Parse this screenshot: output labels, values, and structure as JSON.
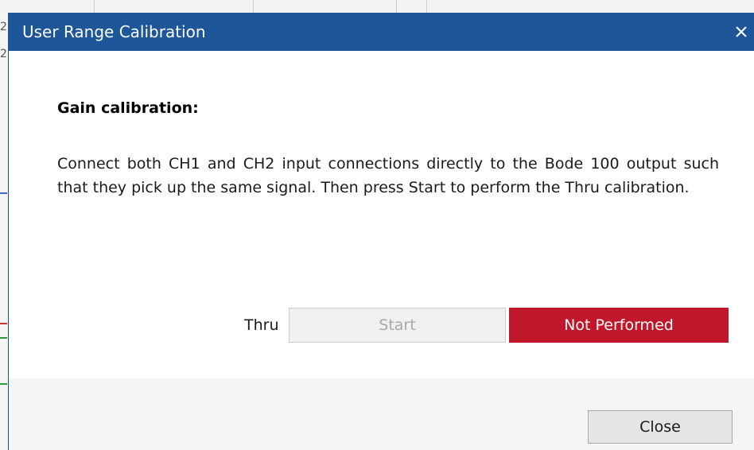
{
  "dialog": {
    "title": "User Range Calibration",
    "close_icon": "close-icon"
  },
  "content": {
    "heading": "Gain calibration:",
    "instructions": "Connect both CH1 and CH2 input connections directly to the Bode 100 output such that they pick up the same signal. Then press Start to perform the Thru calibration."
  },
  "calibration_row": {
    "label": "Thru",
    "start_label": "Start",
    "status": "Not Performed",
    "status_color": "#c0182a"
  },
  "footer": {
    "close_label": "Close"
  },
  "background": {
    "edge_digits": [
      "2",
      "2"
    ]
  },
  "colors": {
    "titlebar": "#1d5699",
    "status_badge": "#c0182a"
  }
}
